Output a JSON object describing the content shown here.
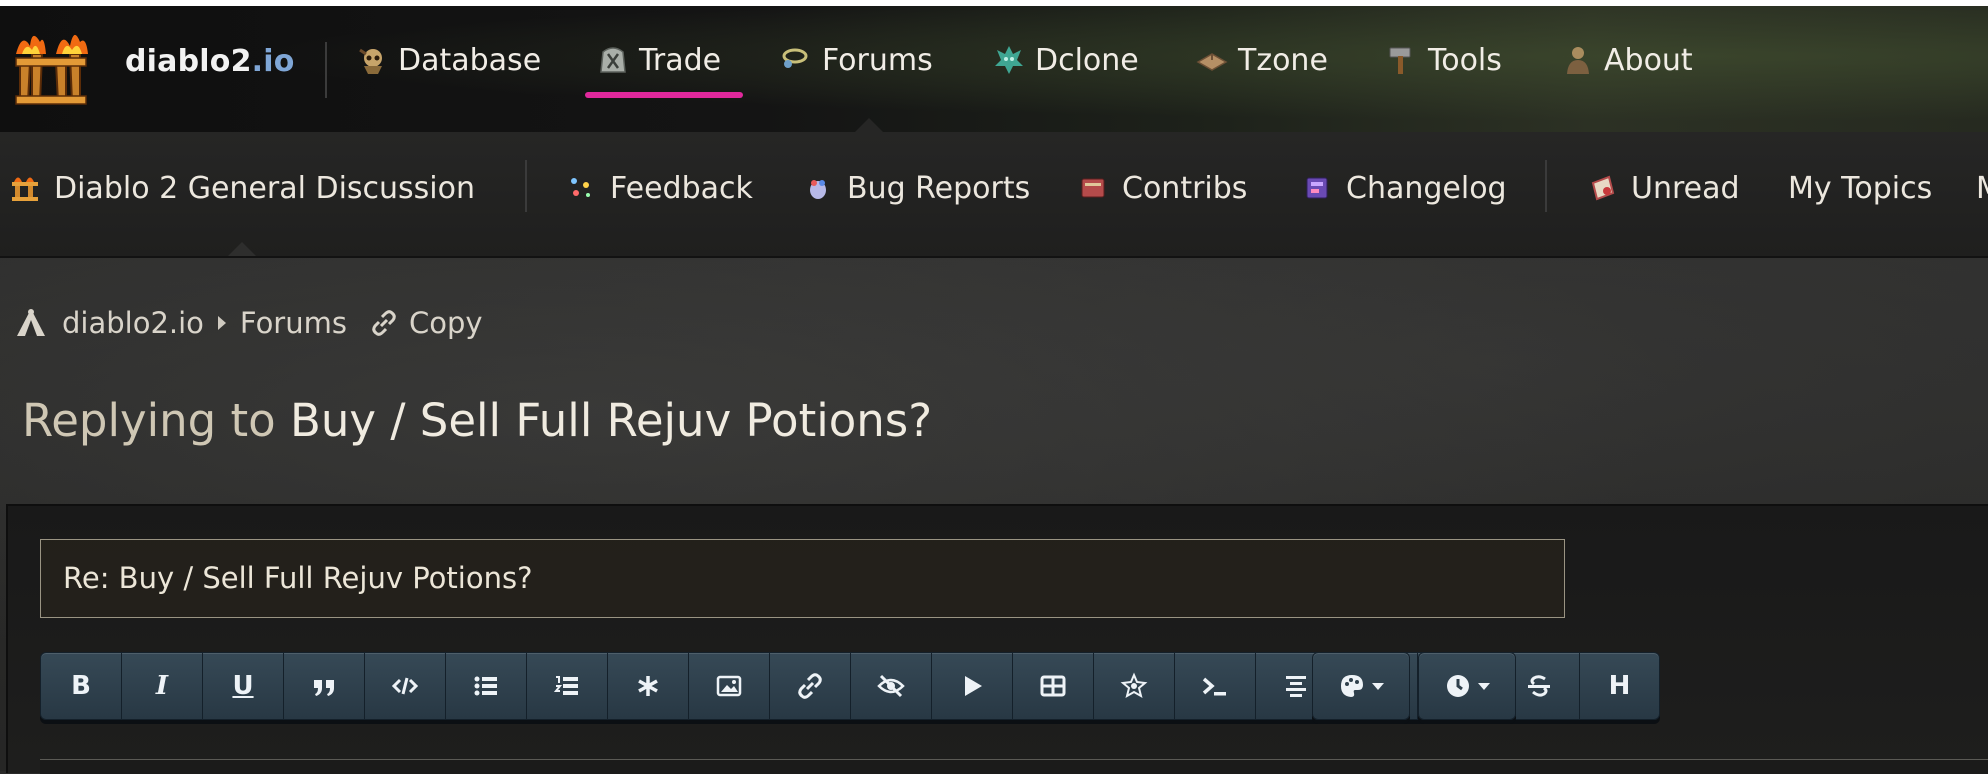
{
  "brand": {
    "part1": "diablo2",
    "part2": ".io"
  },
  "nav": {
    "items": [
      {
        "label": "Database",
        "icon": "skull-icon"
      },
      {
        "label": "Trade",
        "icon": "rune-stone-icon",
        "active": true
      },
      {
        "label": "Forums",
        "icon": "amulet-icon"
      },
      {
        "label": "Dclone",
        "icon": "demon-head-icon"
      },
      {
        "label": "Tzone",
        "icon": "map-icon"
      },
      {
        "label": "Tools",
        "icon": "hammer-icon"
      },
      {
        "label": "About",
        "icon": "character-icon"
      }
    ]
  },
  "subnav": {
    "items": [
      {
        "label": "Diablo 2 General Discussion",
        "icon": "logo-small-icon"
      },
      {
        "label": "Feedback",
        "icon": "sparkle-icon"
      },
      {
        "label": "Bug Reports",
        "icon": "bug-icon"
      },
      {
        "label": "Contribs",
        "icon": "book-icon"
      },
      {
        "label": "Changelog",
        "icon": "tome-icon"
      },
      {
        "label": "Unread",
        "icon": "scroll-icon"
      },
      {
        "label": "My Topics"
      }
    ]
  },
  "breadcrumb": {
    "home": "diablo2.io",
    "forums": "Forums",
    "copy": "Copy"
  },
  "page": {
    "title_prefix": "Replying to",
    "title": "Buy / Sell Full Rejuv Potions?"
  },
  "form": {
    "subject_value": "Re: Buy / Sell Full Rejuv Potions?"
  },
  "toolbar": {
    "bold": "B",
    "italic": "I",
    "underline": "U",
    "heading": "H",
    "buttons": [
      "bold-icon",
      "italic-icon",
      "underline-icon",
      "quote-icon",
      "code-icon",
      "bullet-list-icon",
      "numbered-list-icon",
      "list-item-icon",
      "image-icon",
      "link-icon",
      "spoiler-icon",
      "video-icon",
      "table-icon",
      "item-icon",
      "terminal-icon",
      "center-align-icon",
      "horizontal-rule-icon",
      "unlink-icon",
      "strikethrough-icon",
      "heading-icon",
      "color-palette-icon",
      "clock-icon"
    ]
  },
  "colors": {
    "accent": "#e0289c",
    "brand_blue": "#7fa6d6",
    "toolbar": "#2f404c"
  }
}
